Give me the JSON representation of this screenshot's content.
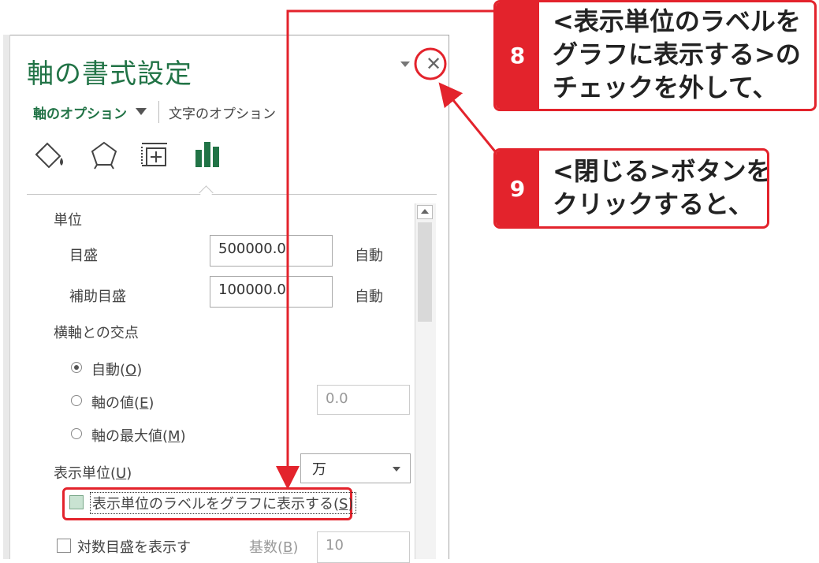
{
  "pane": {
    "title": "軸の書式設定",
    "tabs": {
      "axis_options": "軸のオプション",
      "text_options": "文字のオプション"
    },
    "icons": [
      "fill-line-icon",
      "effects-icon",
      "size-properties-icon",
      "axis-options-icon"
    ],
    "accent_color": "#217346"
  },
  "units": {
    "heading": "単位",
    "major_label": "目盛",
    "major_value": "500000.0",
    "major_auto": "自動",
    "minor_label": "補助目盛",
    "minor_value": "100000.0",
    "minor_auto": "自動"
  },
  "crosses": {
    "heading": "横軸との交点",
    "auto_label": "自動(",
    "auto_key": "O",
    "value_label": "軸の値(",
    "value_key": "E",
    "value_input": "0.0",
    "max_label": "軸の最大値(",
    "max_key": "M",
    "close_paren": ")",
    "selected": "auto"
  },
  "display_units": {
    "label": "表示単位(",
    "key": "U",
    "selected": "万",
    "show_label_text": "表示単位のラベルをグラフに表示する(",
    "show_label_key": "S",
    "show_label_checked": true
  },
  "log_scale": {
    "label": "対数目盛を表示す",
    "base_label": "基数(",
    "base_key": "B",
    "base_value": "10"
  },
  "callouts": [
    {
      "num": "8",
      "lines": [
        "<表示単位のラベルを",
        "グラフに表示する>の",
        "チェックを外して、"
      ]
    },
    {
      "num": "9",
      "lines": [
        "<閉じる>ボタンを",
        "クリックすると、"
      ]
    }
  ],
  "colors": {
    "callout_red": "#e3232c",
    "brand_green": "#217346"
  }
}
